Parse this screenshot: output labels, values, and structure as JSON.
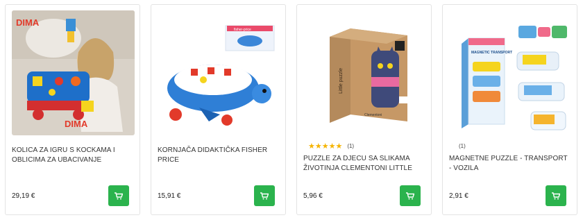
{
  "products": [
    {
      "title": "KOLICA ZA IGRU S KOCKAMA I OBLICIMA ZA UBACIVANJE",
      "price": "29,19 €",
      "rating_count": "",
      "brand_watermark": "DIMA"
    },
    {
      "title": "KORNJAČA DIDAKTIČKA FISHER PRICE",
      "price": "15,91 €",
      "rating_count": "",
      "box_label": "fisher-price"
    },
    {
      "title": "PUZZLE ZA DJECU SA SLIKAMA ŽIVOTINJA CLEMENTONI LITTLE",
      "price": "5,96 €",
      "rating_count": "(1)",
      "stars": "★★★★★",
      "box_label": "Little puzzle",
      "box_brand": "Clementoni"
    },
    {
      "title": "MAGNETNE PUZZLE - TRANSPORT - VOZILA",
      "price": "2,91 €",
      "rating_count": "(1)",
      "stars": "",
      "box_label": "MAGNETIC TRANSPORT"
    }
  ],
  "colors": {
    "cart_button": "#2bb34d",
    "star": "#f5b400"
  },
  "icons": {
    "cart": "shopping-cart-icon"
  }
}
